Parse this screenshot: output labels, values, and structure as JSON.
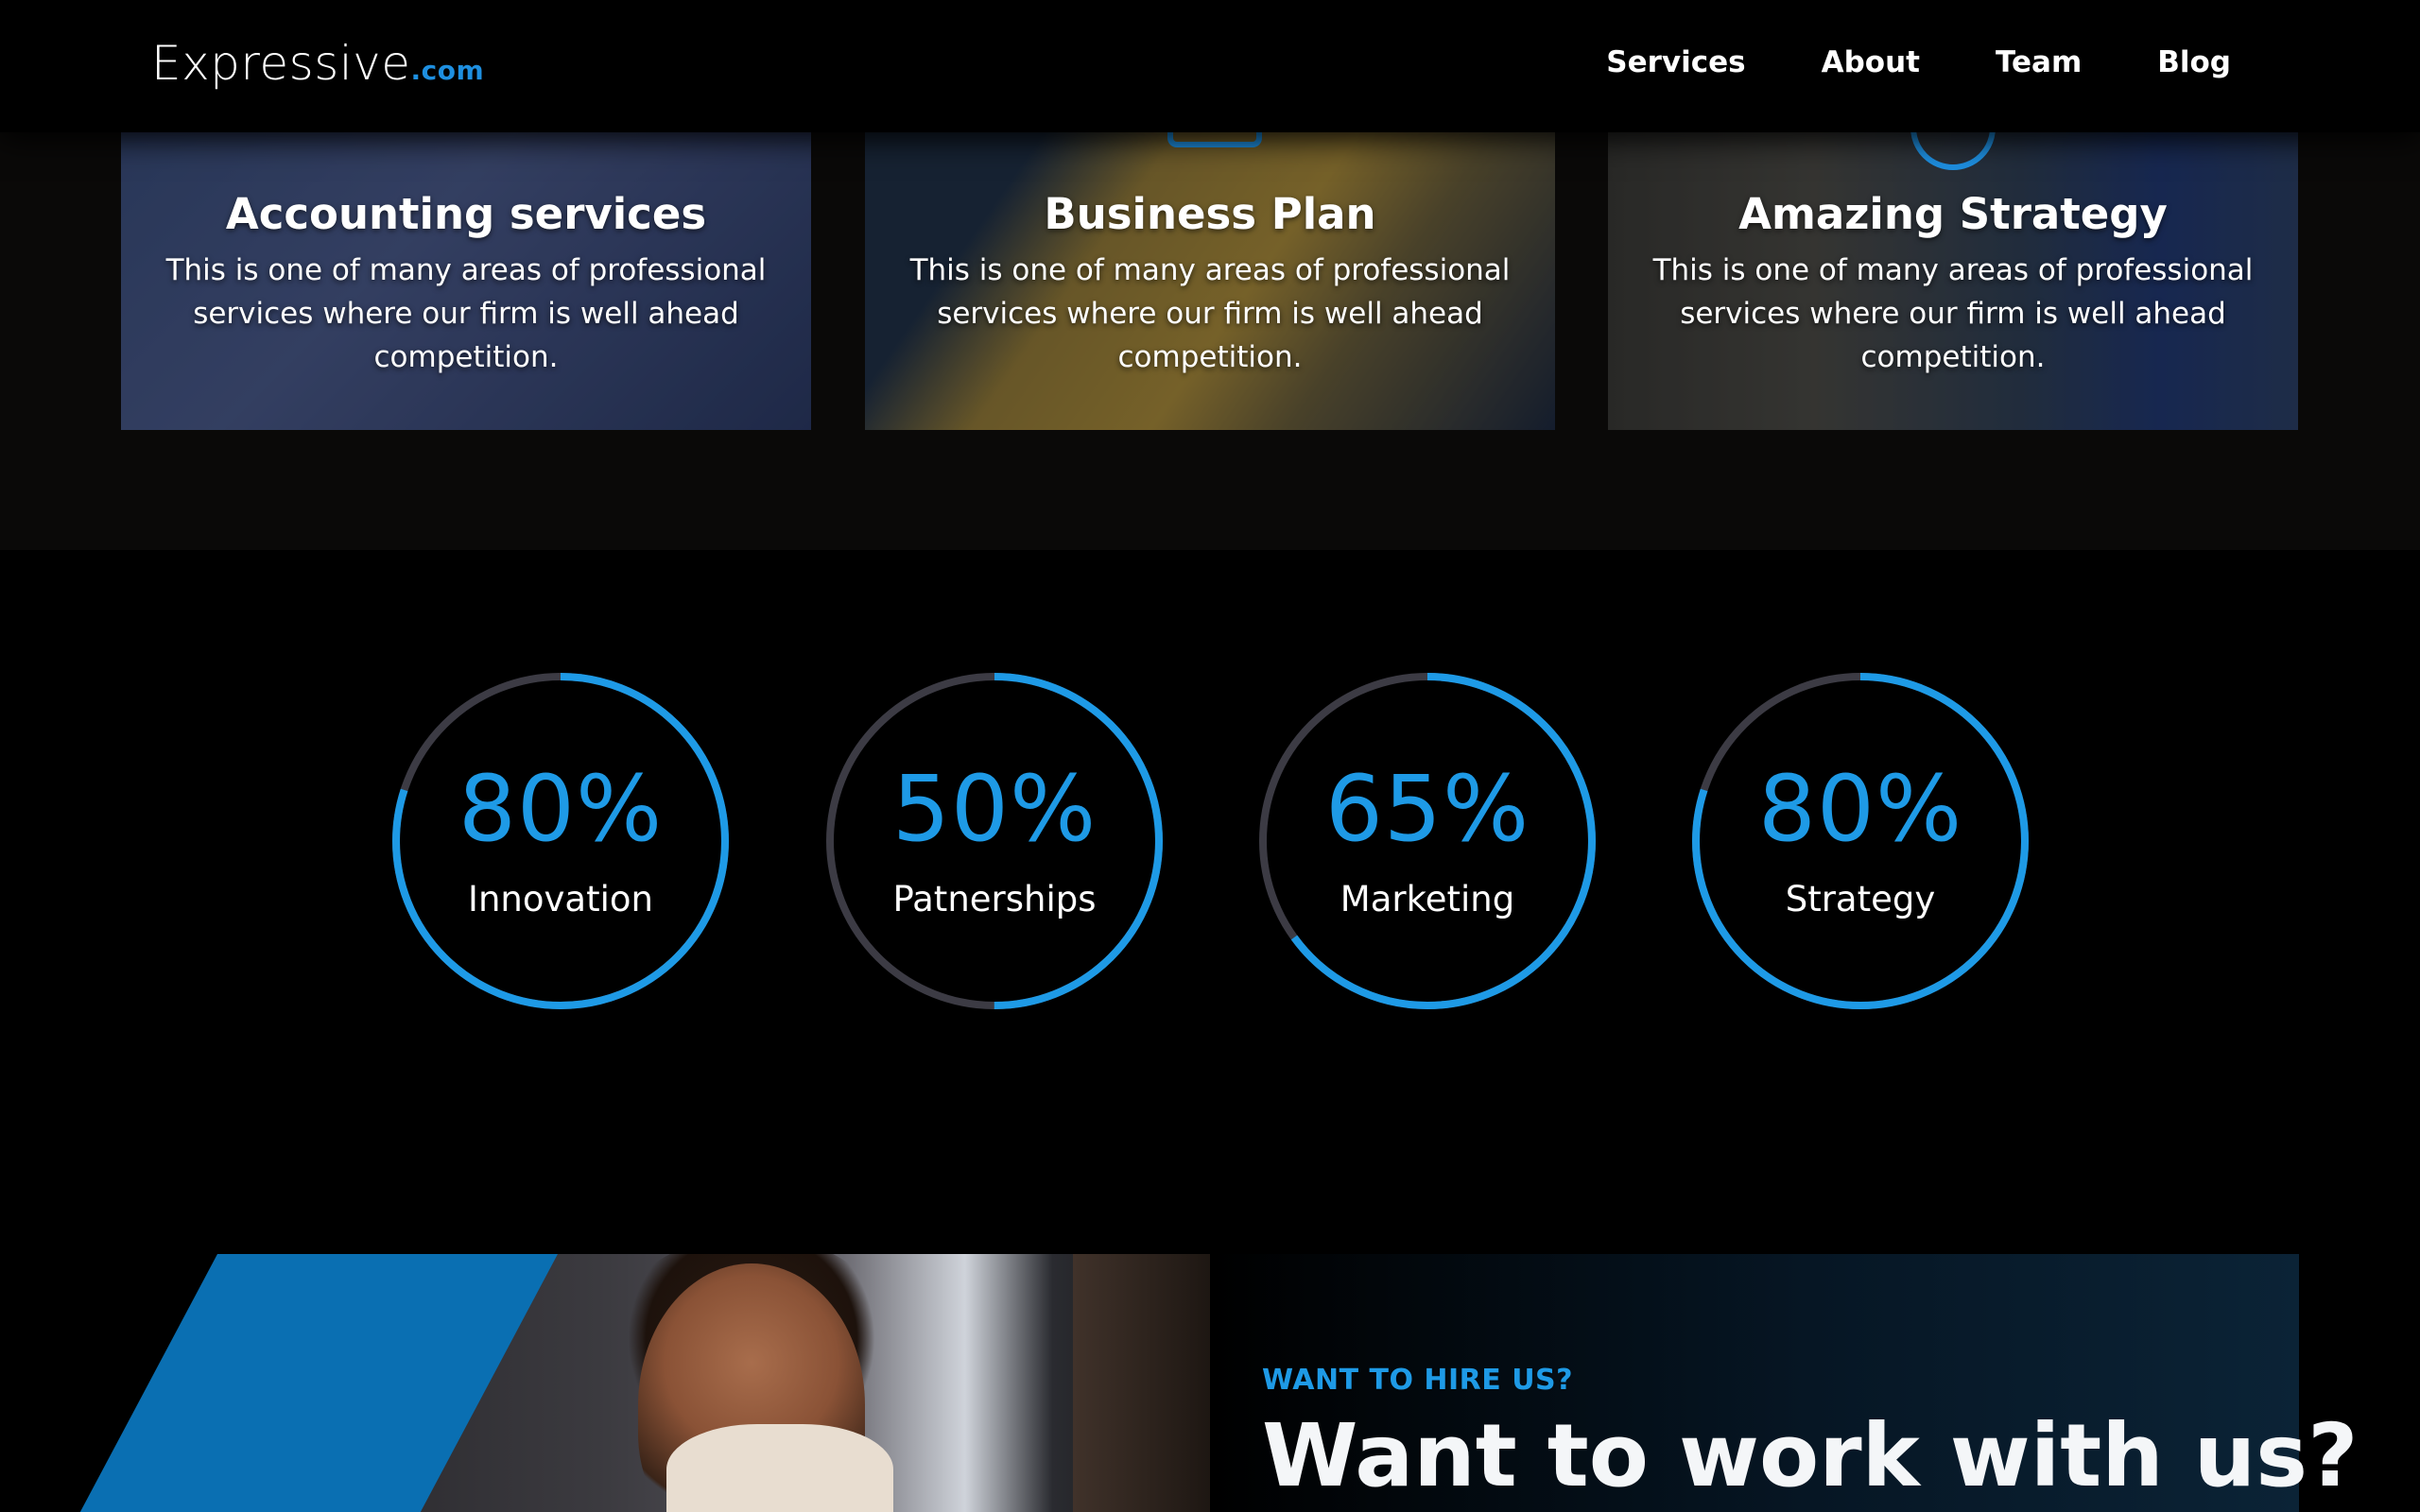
{
  "brand": {
    "name": "Expressive",
    "tld": ".com"
  },
  "nav": {
    "items": [
      "Services",
      "About",
      "Team",
      "Blog"
    ]
  },
  "services": [
    {
      "title": "Accounting services",
      "text": "This is one of many areas of professional services where our firm is well ahead competition."
    },
    {
      "title": "Business Plan",
      "text": "This is one of many areas of professional services where our firm is well ahead competition."
    },
    {
      "title": "Amazing Strategy",
      "text": "This is one of many areas of professional services where our firm is well ahead competition."
    }
  ],
  "stats": [
    {
      "value": "80%",
      "label": "Innovation",
      "percent": 80
    },
    {
      "value": "50%",
      "label": "Patnerships",
      "percent": 50
    },
    {
      "value": "65%",
      "label": "Marketing",
      "percent": 65
    },
    {
      "value": "80%",
      "label": "Strategy",
      "percent": 80
    }
  ],
  "cta": {
    "eyebrow": "WANT TO HIRE US?",
    "title": "Want to work with us?"
  },
  "colors": {
    "accent": "#1e9ae6",
    "track": "#3c3b44",
    "stripe": "#0a6fb2",
    "background": "#000000"
  }
}
